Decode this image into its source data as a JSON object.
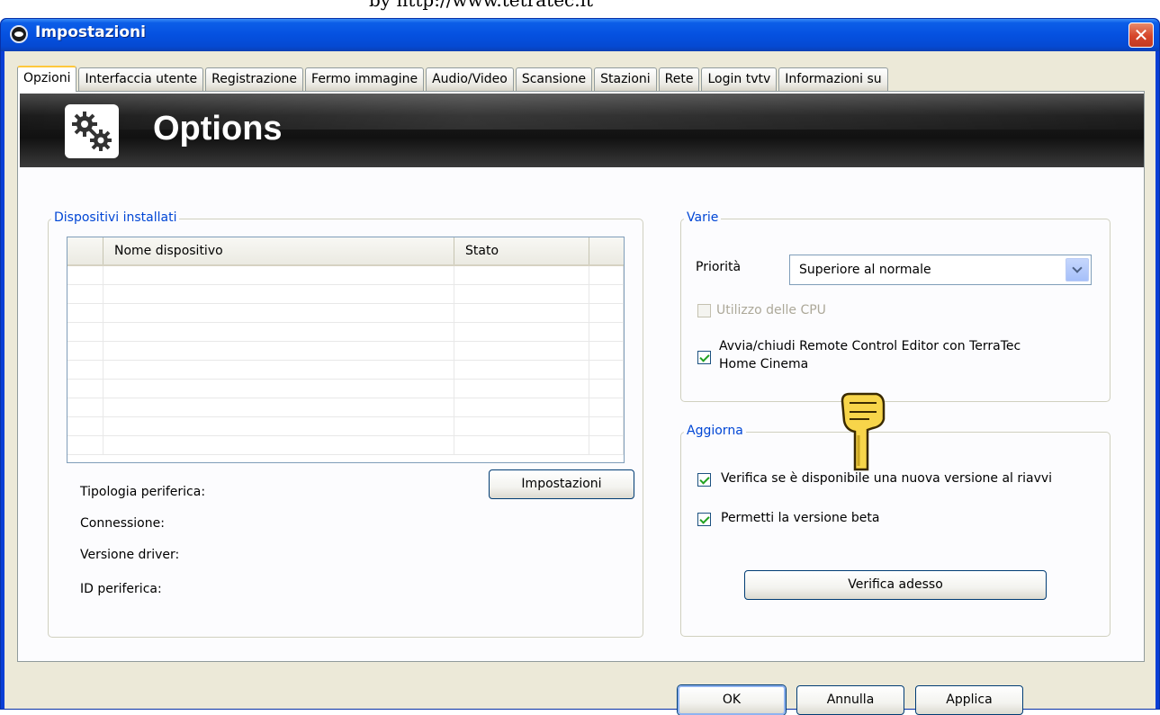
{
  "top_text": "by http://www.tetratec.it",
  "window": {
    "title": "Impostazioni"
  },
  "tabs": [
    {
      "label": "Opzioni",
      "active": true
    },
    {
      "label": "Interfaccia utente"
    },
    {
      "label": "Registrazione"
    },
    {
      "label": "Fermo immagine"
    },
    {
      "label": "Audio/Video"
    },
    {
      "label": "Scansione"
    },
    {
      "label": "Stazioni"
    },
    {
      "label": "Rete"
    },
    {
      "label": "Login tvtv"
    },
    {
      "label": "Informazioni su"
    }
  ],
  "banner": {
    "title": "Options",
    "icon": "gears-icon"
  },
  "devices": {
    "legend": "Dispositivi installati",
    "columns": [
      "Nome dispositivo",
      "Stato"
    ],
    "rows": 10,
    "impostazioni_label": "Impostazioni",
    "info_labels": [
      "Tipologia periferica:",
      "Connessione:",
      "Versione driver:",
      "ID periferica:"
    ]
  },
  "varie": {
    "legend": "Varie",
    "priority_label": "Priorità",
    "priority_value": "Superiore al normale",
    "cpu_label": "Utilizzo delle CPU",
    "cpu_checked": false,
    "remote_label_1": "Avvia/chiudi Remote Control Editor con TerraTec",
    "remote_label_2": "Home Cinema",
    "remote_checked": true
  },
  "aggiorna": {
    "legend": "Aggiorna",
    "check_new_label": "Verifica se è disponibile una nuova versione al riavvi",
    "check_new_checked": true,
    "beta_label": "Permetti la versione beta",
    "beta_checked": true,
    "verify_now_label": "Verifica adesso"
  },
  "footer": {
    "ok": "OK",
    "cancel": "Annulla",
    "apply": "Applica"
  },
  "colors": {
    "title_blue": "#0551e0",
    "legend_blue": "#0046d5",
    "close_red": "#d6452a"
  }
}
